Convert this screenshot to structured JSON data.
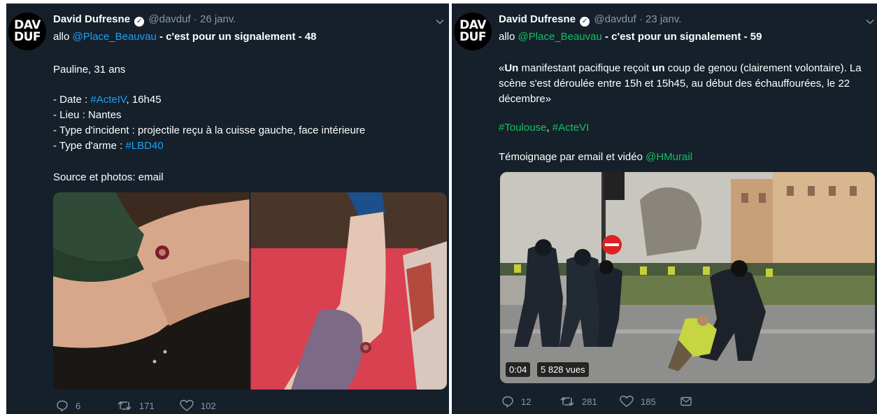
{
  "tweet1": {
    "avatar": {
      "line1": "DAV",
      "line2": "DUF"
    },
    "name": "David Dufresne",
    "handle": "@davduf",
    "separator": "·",
    "date": "26 janv.",
    "intro": {
      "prefix": "allo ",
      "mention": "@Place_Beauvau",
      "title": " - c'est pour un signalement - 48"
    },
    "person": "Pauline, 31 ans",
    "date_line": {
      "prefix": "- Date : ",
      "hashtag": "#ActeIV",
      "suffix": ", 16h45"
    },
    "lieu": "- Lieu : Nantes",
    "incident": "- Type d'incident : projectile reçu à la cuisse gauche, face intérieure",
    "arme": {
      "prefix": "- Type d'arme : ",
      "hashtag": "#LBD40"
    },
    "source": "Source et photos: email",
    "actions": {
      "replies": "6",
      "retweets": "171",
      "likes": "102"
    }
  },
  "tweet2": {
    "avatar": {
      "line1": "DAV",
      "line2": "DUF"
    },
    "name": "David Dufresne",
    "handle": "@davduf",
    "separator": "·",
    "date": "23 janv.",
    "intro": {
      "prefix": "allo ",
      "mention": "@Place_Beauvau",
      "title": " - c'est pour un signalement - 59"
    },
    "quote": {
      "open": "«",
      "un1": "Un",
      "part1": " manifestant pacifique reçoit ",
      "un2": "un",
      "part2": " coup de genou (clairement volontaire). La",
      "line2": "scène s'est déroulée entre 15h et 15h45, au début des échauffourées, le 22",
      "line3": "décembre»"
    },
    "hashtags": {
      "h1": "#Toulouse",
      "sep": ", ",
      "h2": "#ActeVI"
    },
    "testimony": {
      "prefix": "Témoignage par email et vidéo ",
      "mention": "@HMurail"
    },
    "video": {
      "time": "0:04",
      "views": "5 828 vues"
    },
    "actions": {
      "replies": "12",
      "retweets": "281",
      "likes": "185"
    }
  },
  "colors": {
    "background": "#15202b",
    "link": "#1da1f2",
    "hashtag_green": "#17bf63",
    "muted": "#8899a6"
  }
}
